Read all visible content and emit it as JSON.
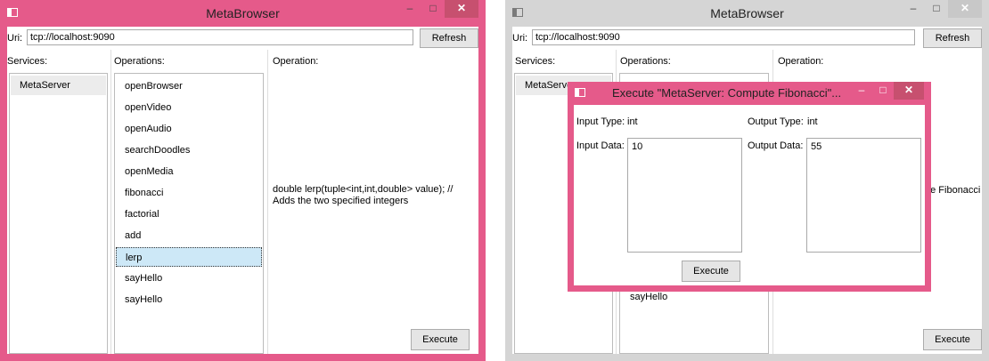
{
  "left_window": {
    "title": "MetaBrowser",
    "uri_label": "Uri:",
    "uri_value": "tcp://localhost:9090",
    "refresh_label": "Refresh",
    "services_header": "Services:",
    "operations_header": "Operations:",
    "operation_header": "Operation:",
    "services": [
      "MetaServer"
    ],
    "operations": [
      "openBrowser",
      "openVideo",
      "openAudio",
      "searchDoodles",
      "openMedia",
      "fibonacci",
      "factorial",
      "add",
      "lerp",
      "sayHello",
      "sayHello"
    ],
    "selected_operation": "lerp",
    "operation_description": "double lerp(tuple<int,int,double> value); // Adds the two specified integers",
    "execute_label": "Execute",
    "accent_color": "#e55a8a"
  },
  "right_window": {
    "title": "MetaBrowser",
    "uri_label": "Uri:",
    "uri_value": "tcp://localhost:9090",
    "refresh_label": "Refresh",
    "services_header": "Services:",
    "operations_header": "Operations:",
    "operation_header": "Operation:",
    "services": [
      "MetaServer"
    ],
    "visible_operation": "sayHello",
    "operation_partial_text": "he Fibonacci",
    "execute_label": "Execute"
  },
  "dialog": {
    "title": "Execute \"MetaServer: Compute Fibonacci\"...",
    "input_type_label": "Input Type:",
    "input_type_value": "int",
    "output_type_label": "Output Type:",
    "output_type_value": "int",
    "input_data_label": "Input Data:",
    "input_data_value": "10",
    "output_data_label": "Output Data:",
    "output_data_value": "55",
    "execute_label": "Execute"
  }
}
